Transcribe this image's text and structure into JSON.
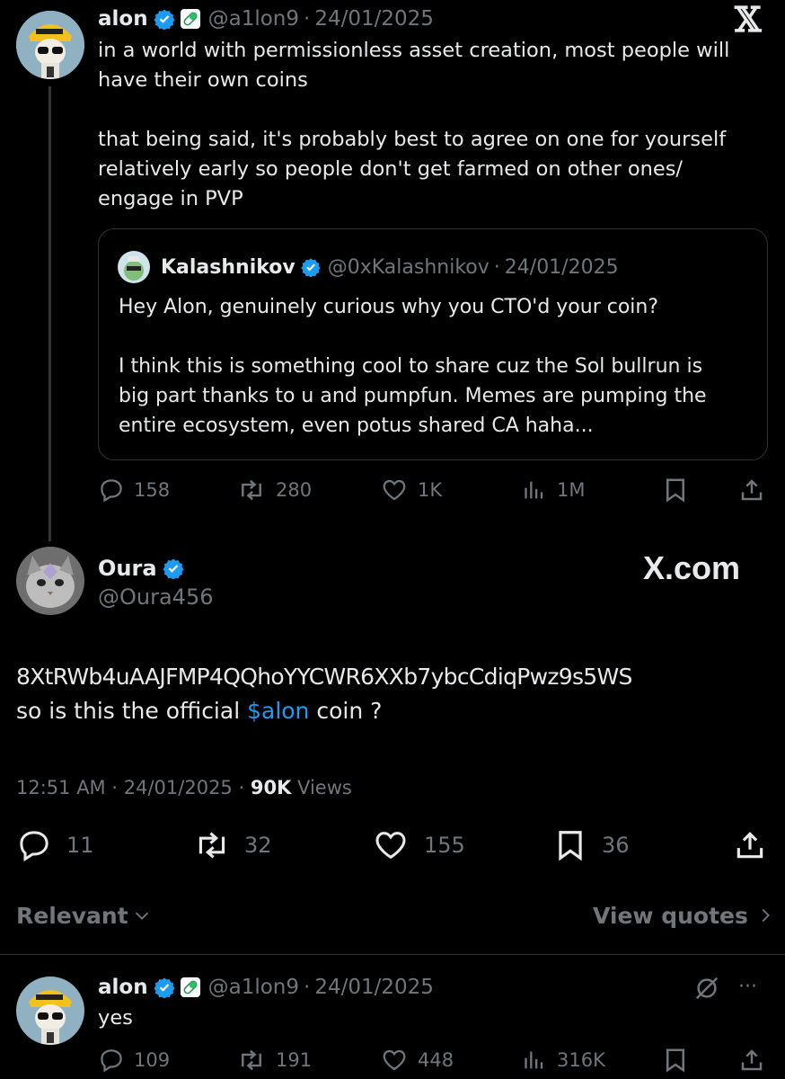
{
  "colors": {
    "accent": "#1d9bf0",
    "muted": "#71767b",
    "text": "#e7e9ea",
    "verified": "#1d9bf0",
    "background": "#000000"
  },
  "tweet1": {
    "name": "alon",
    "handle": "@a1lon9",
    "sep": "·",
    "date": "24/01/2025",
    "x_logo": "𝕏",
    "text": "in a world with permissionless asset creation, most people will\nhave their own coins\n\nthat being said, it's probably best to agree on one for yourself\nrelatively early so people don't get farmed on other ones/\nengage in PVP",
    "quote": {
      "name": "Kalashnikov",
      "handle": "@0xKalashnikov",
      "sep": "·",
      "date": "24/01/2025",
      "text": "Hey Alon, genuinely curious why you CTO'd your coin?\n\nI think this is something cool to share cuz the Sol bullrun is\nbig part thanks to u and pumpfun. Memes are pumping the\nentire ecosystem, even potus shared CA haha..."
    },
    "stats": {
      "replies": "158",
      "reposts": "280",
      "likes": "1K",
      "views": "1M"
    }
  },
  "tweet2": {
    "name": "Oura",
    "handle": "@Oura456",
    "watermark": "X.com",
    "contract": "8XtRWb4uAAJFMP4QQhoYYCWR6XXb7ybcCdiqPwz9s5WS",
    "line2_before": "so is this the official ",
    "cashtag": "$alon",
    "line2_after": " coin ?",
    "time": "12:51 AM",
    "date": "24/01/2025",
    "sep": "·",
    "views_count": "90K",
    "views_label": "Views",
    "stats": {
      "replies": "11",
      "reposts": "32",
      "likes": "155",
      "bookmarks": "36"
    }
  },
  "filter": {
    "label": "Relevant",
    "view_quotes": "View quotes"
  },
  "reply": {
    "name": "alon",
    "handle": "@a1lon9",
    "sep": "·",
    "date": "24/01/2025",
    "more": "···",
    "text": "yes",
    "stats": {
      "replies": "109",
      "reposts": "191",
      "likes": "448",
      "views": "316K"
    }
  }
}
